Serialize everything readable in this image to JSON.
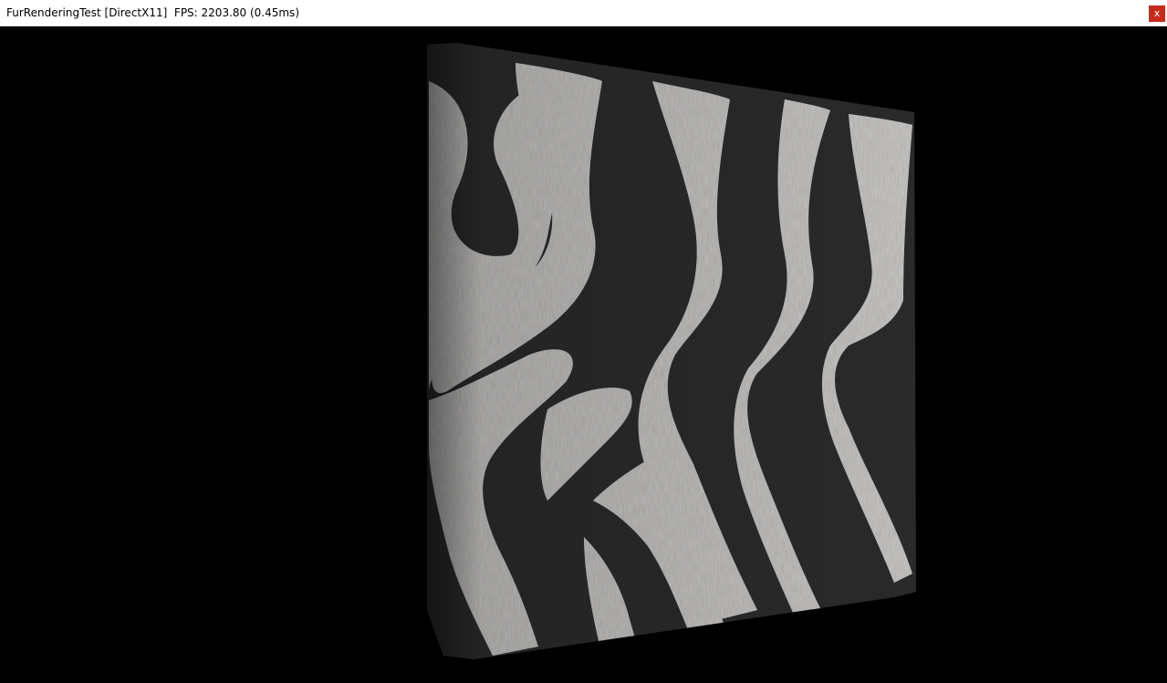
{
  "window": {
    "title": "FurRenderingTest [DirectX11]  FPS: 2203.80 (0.45ms)",
    "close_label": "x",
    "close_color": "#c42b1c"
  },
  "viewport": {
    "background": "#000000",
    "subject": "fur-covered quad with zebra stripe texture"
  }
}
